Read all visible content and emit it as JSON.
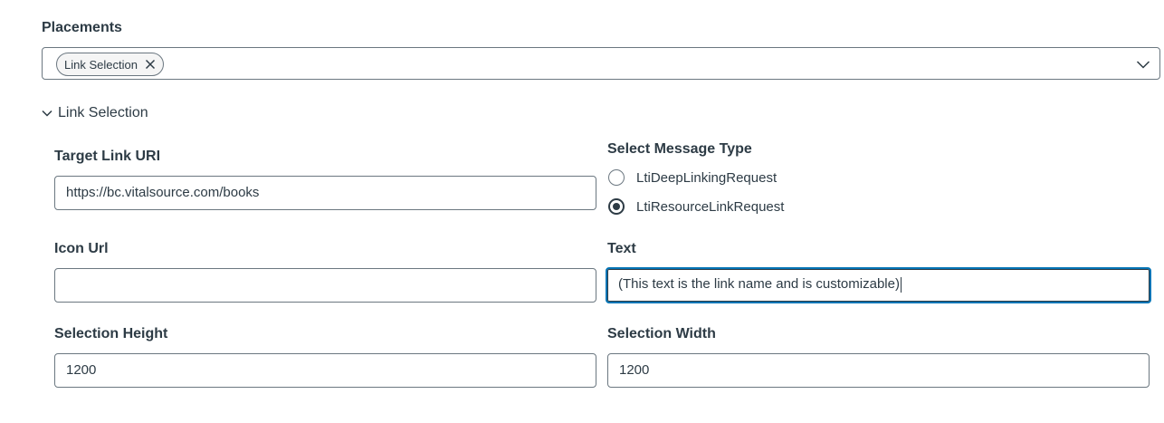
{
  "placements": {
    "label": "Placements",
    "selected_tags": [
      {
        "label": "Link Selection"
      }
    ]
  },
  "section": {
    "toggle_label": "Link Selection"
  },
  "target_link_uri": {
    "label": "Target Link URI",
    "value": "https://bc.vitalsource.com/books"
  },
  "message_type": {
    "label": "Select Message Type",
    "options": [
      {
        "label": "LtiDeepLinkingRequest",
        "checked": false
      },
      {
        "label": "LtiResourceLinkRequest",
        "checked": true
      }
    ]
  },
  "icon_url": {
    "label": "Icon Url",
    "value": ""
  },
  "text": {
    "label": "Text",
    "value": "(This text is the link name and is customizable)"
  },
  "selection_height": {
    "label": "Selection Height",
    "value": "1200"
  },
  "selection_width": {
    "label": "Selection Width",
    "value": "1200"
  },
  "colors": {
    "text": "#2d3b45",
    "border": "#6b7780",
    "focus": "#0374b5"
  }
}
